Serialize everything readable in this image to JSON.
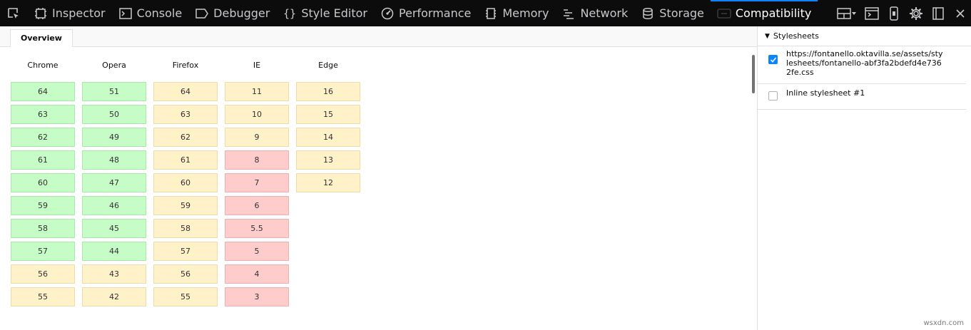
{
  "toolbar": {
    "tabs": [
      {
        "label": "Inspector",
        "icon": "inspector-icon"
      },
      {
        "label": "Console",
        "icon": "console-icon"
      },
      {
        "label": "Debugger",
        "icon": "debugger-icon"
      },
      {
        "label": "Style Editor",
        "icon": "style-editor-icon"
      },
      {
        "label": "Performance",
        "icon": "performance-icon"
      },
      {
        "label": "Memory",
        "icon": "memory-icon"
      },
      {
        "label": "Network",
        "icon": "network-icon"
      },
      {
        "label": "Storage",
        "icon": "storage-icon"
      },
      {
        "label": "Compatibility",
        "icon": "compatibility-icon"
      }
    ],
    "active_tab": "Compatibility",
    "accent_color": "#0a84ff"
  },
  "subtab": {
    "label": "Overview"
  },
  "browsers": [
    {
      "name": "Chrome",
      "versions": [
        {
          "v": "64",
          "s": "supported"
        },
        {
          "v": "63",
          "s": "supported"
        },
        {
          "v": "62",
          "s": "supported"
        },
        {
          "v": "61",
          "s": "supported"
        },
        {
          "v": "60",
          "s": "supported"
        },
        {
          "v": "59",
          "s": "supported"
        },
        {
          "v": "58",
          "s": "supported"
        },
        {
          "v": "57",
          "s": "supported"
        },
        {
          "v": "56",
          "s": "partial"
        },
        {
          "v": "55",
          "s": "partial"
        }
      ]
    },
    {
      "name": "Opera",
      "versions": [
        {
          "v": "51",
          "s": "supported"
        },
        {
          "v": "50",
          "s": "supported"
        },
        {
          "v": "49",
          "s": "supported"
        },
        {
          "v": "48",
          "s": "supported"
        },
        {
          "v": "47",
          "s": "supported"
        },
        {
          "v": "46",
          "s": "supported"
        },
        {
          "v": "45",
          "s": "supported"
        },
        {
          "v": "44",
          "s": "supported"
        },
        {
          "v": "43",
          "s": "partial"
        },
        {
          "v": "42",
          "s": "partial"
        }
      ]
    },
    {
      "name": "Firefox",
      "versions": [
        {
          "v": "64",
          "s": "partial"
        },
        {
          "v": "63",
          "s": "partial"
        },
        {
          "v": "62",
          "s": "partial"
        },
        {
          "v": "61",
          "s": "partial"
        },
        {
          "v": "60",
          "s": "partial"
        },
        {
          "v": "59",
          "s": "partial"
        },
        {
          "v": "58",
          "s": "partial"
        },
        {
          "v": "57",
          "s": "partial"
        },
        {
          "v": "56",
          "s": "partial"
        },
        {
          "v": "55",
          "s": "partial"
        }
      ]
    },
    {
      "name": "IE",
      "versions": [
        {
          "v": "11",
          "s": "partial"
        },
        {
          "v": "10",
          "s": "partial"
        },
        {
          "v": "9",
          "s": "partial"
        },
        {
          "v": "8",
          "s": "unsupported"
        },
        {
          "v": "7",
          "s": "unsupported"
        },
        {
          "v": "6",
          "s": "unsupported"
        },
        {
          "v": "5.5",
          "s": "unsupported"
        },
        {
          "v": "5",
          "s": "unsupported"
        },
        {
          "v": "4",
          "s": "unsupported"
        },
        {
          "v": "3",
          "s": "unsupported"
        }
      ]
    },
    {
      "name": "Edge",
      "versions": [
        {
          "v": "16",
          "s": "partial"
        },
        {
          "v": "15",
          "s": "partial"
        },
        {
          "v": "14",
          "s": "partial"
        },
        {
          "v": "13",
          "s": "partial"
        },
        {
          "v": "12",
          "s": "partial"
        }
      ]
    }
  ],
  "status_colors": {
    "supported": "#c6fcc6",
    "partial": "#fff1c8",
    "unsupported": "#ffcccc"
  },
  "stylesheets": {
    "heading": "Stylesheets",
    "items": [
      {
        "label": "https://fontanello.oktavilla.se/assets/stylesheets/fontanello-abf3fa2bdefd4e7362fe.css",
        "checked": true
      },
      {
        "label": "Inline stylesheet #1",
        "checked": false
      }
    ]
  },
  "watermark": "wsxdn.com"
}
